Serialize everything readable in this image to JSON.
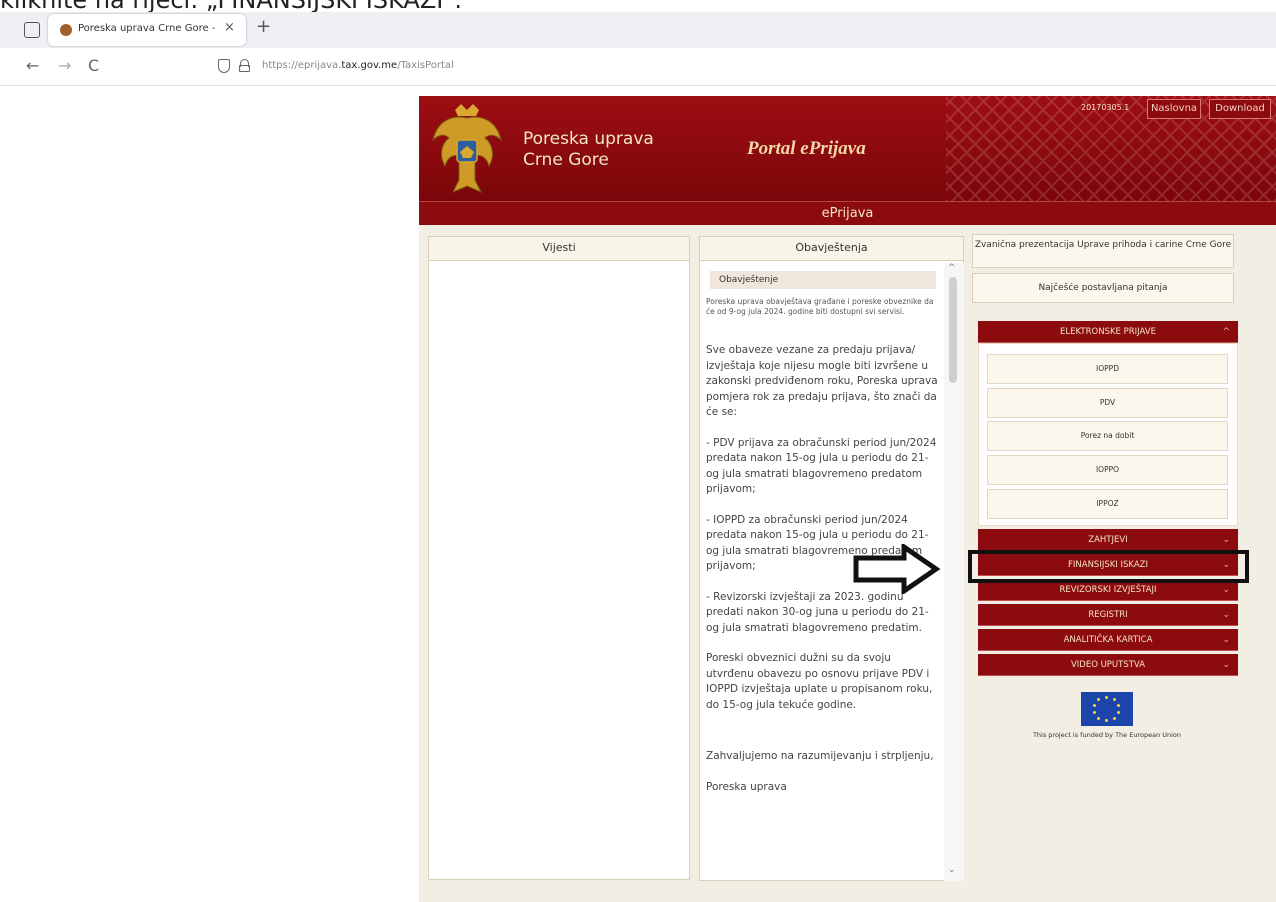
{
  "caption": "kliknite na riječi: „FINANSIJSKI ISKAZI\".",
  "browser": {
    "tab_title": "Poreska uprava Crne Gore - Taxi",
    "tab_close": "×",
    "new_tab": "+",
    "url_prefix": "https://eprijava.",
    "url_domain": "tax.gov.me",
    "url_path": "/TaxisPortal",
    "back": "←",
    "forward": "→",
    "reload": "C"
  },
  "portal": {
    "agency_line1": "Poreska uprava",
    "agency_line2": "Crne Gore",
    "title": "Portal ePrijava",
    "version": "20170305.1",
    "home": "Naslovna",
    "download": "Download",
    "subbar": "ePrijava"
  },
  "columns": {
    "news_header": "Vijesti",
    "notices_header": "Obavještenja"
  },
  "notice": {
    "heading": "Obavještenje",
    "intro": "Poreska uprava obavještava građane i poreske obveznike da će od 9-og jula 2024. godine biti dostupni svi servisi.",
    "p1": "Sve obaveze vezane za predaju prijava/ izvještaja koje nijesu mogle biti izvršene u zakonski predviđenom roku, Poreska uprava pomjera rok za predaju prijava, što znači da će se:",
    "p2": "- PDV prijava za obračunski period jun/2024 predata nakon 15-og jula u periodu do 21-og jula smatrati blagovremeno predatom prijavom;",
    "p3": "- IOPPD za obračunski period jun/2024 predata nakon 15-og jula u periodu do 21-og jula smatrati blagovremeno predatom prijavom;",
    "p4": "- Revizorski izvještaji za 2023. godinu predati nakon 30-og juna u periodu do 21-og jula smatrati blagovremeno predatim.",
    "p5": "Poreski obveznici dužni su da svoju utvrđenu obavezu po osnovu prijave PDV i IOPPD izvještaja uplate u propisanom roku, do 15-og jula tekuće godine.",
    "p6": "Zahvaljujemo na razumijevanju i strpljenju,",
    "p7": "Poreska uprava"
  },
  "links": {
    "official": "Zvanična prezentacija Uprave prihoda i carine Crne Gore",
    "faq": "Najčešće postavljana pitanja"
  },
  "panels": {
    "elektronske": "ELEKTRONSKE PRIJAVE",
    "items": [
      "IOPPD",
      "PDV",
      "Porez na dobit",
      "IOPPO",
      "IPPOZ"
    ],
    "zahtjevi": "ZAHTJEVI",
    "finansijski": "FINANSIJSKI ISKAZI",
    "revizorski": "REVIZORSKI IZVJEŠTAJI",
    "registri": "REGISTRI",
    "analiticka": "ANALITIČKA KARTICA",
    "video": "VIDEO UPUTSTVA",
    "chev_up": "^",
    "chev_down": "⌄"
  },
  "eu_note": "This project is funded by The European Union",
  "scroll": {
    "up": "^",
    "down": "⌄"
  },
  "colors": {
    "portal_red": "#8c0b0e",
    "banner_red": "#9d0e12",
    "portal_bg": "#f2eee3",
    "eu_blue": "#1b45a8"
  }
}
